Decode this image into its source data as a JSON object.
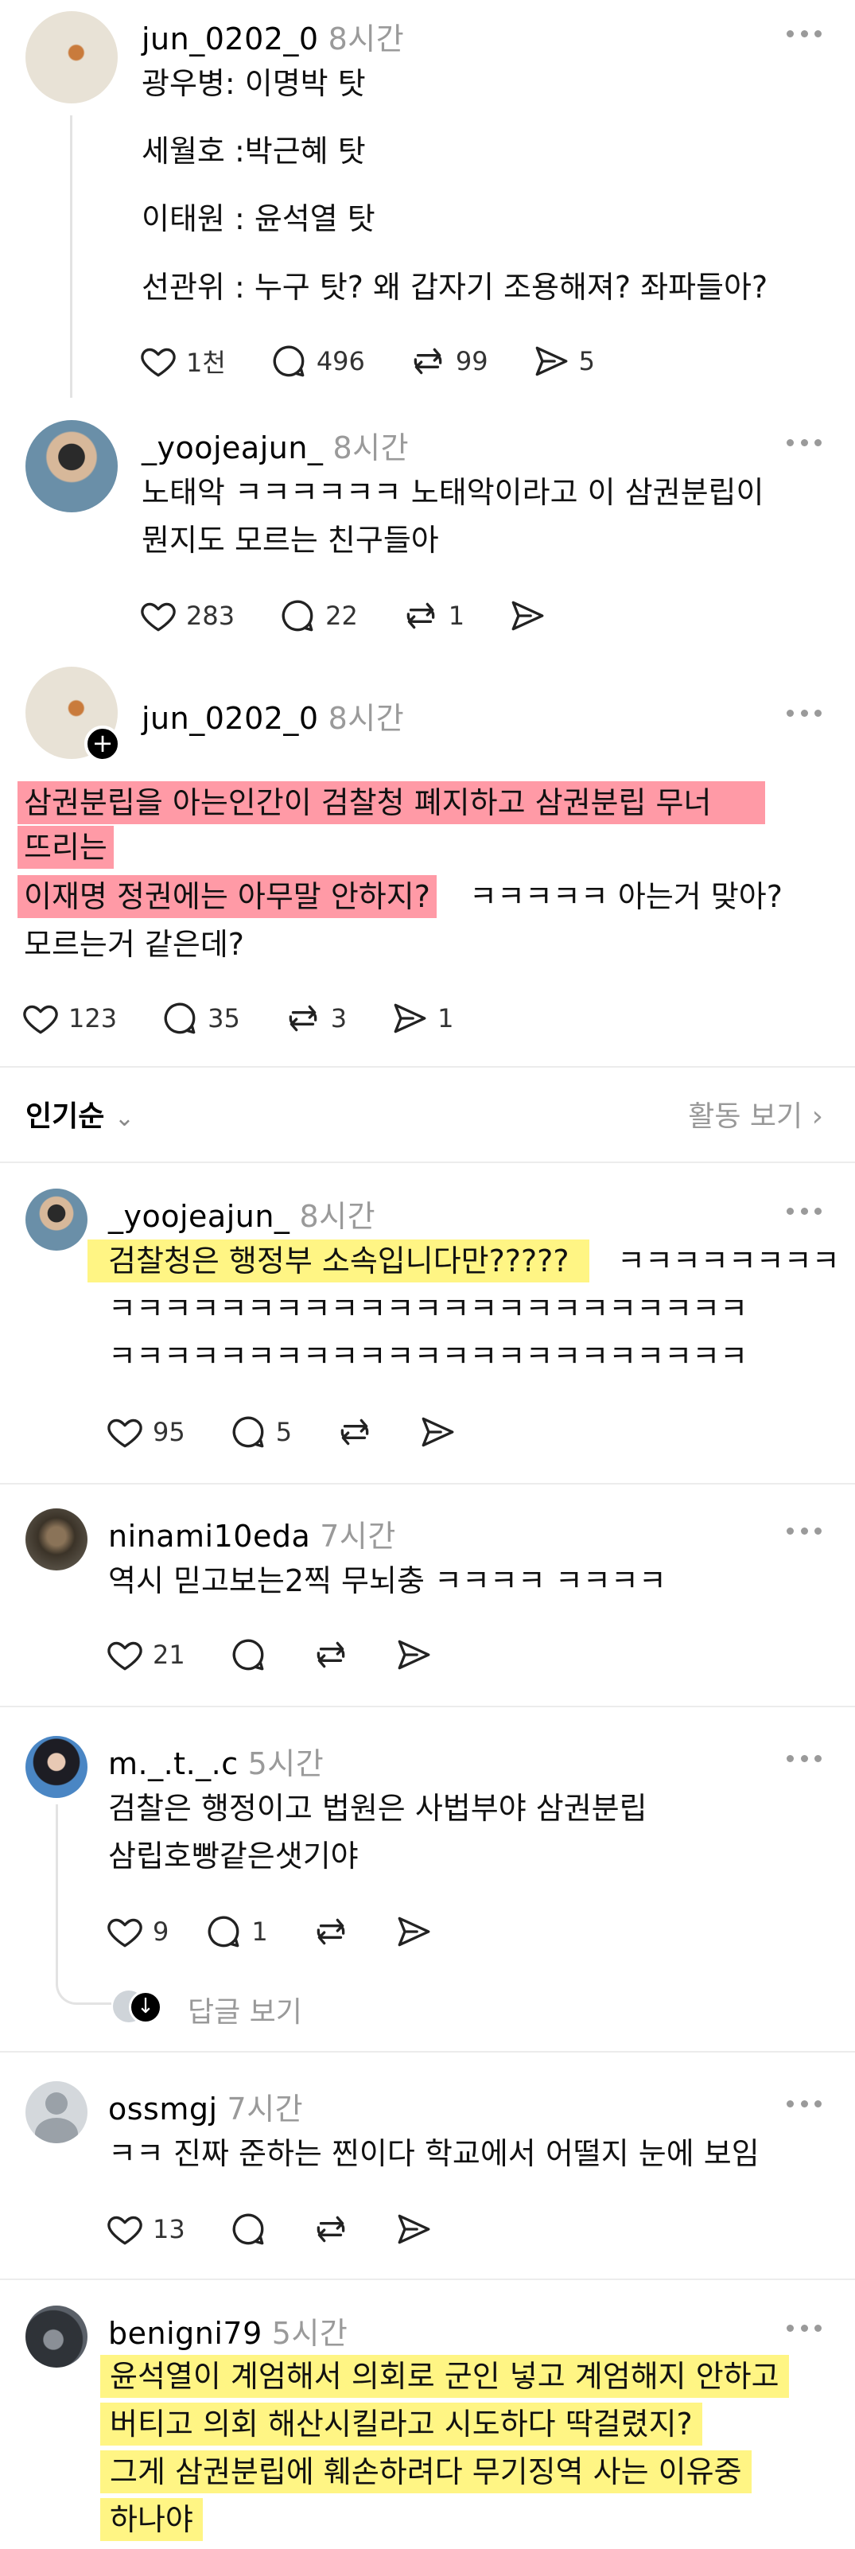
{
  "posts": [
    {
      "username": "jun_0202_0",
      "time": "8시간",
      "lines": [
        "광우병: 이명박 탓",
        "세월호 :박근혜 탓",
        "이태원 : 윤석열 탓",
        "선관위 : 누구 탓? 왜 갑자기 조용해져? 좌파들아?"
      ],
      "likes": "1천",
      "comments": "496",
      "reposts": "99",
      "shares": "5"
    },
    {
      "username": "_yoojeajun_",
      "time": "8시간",
      "lines": [
        "노태악 ㅋㅋㅋㅋㅋㅋ 노태악이라고 이 삼권분립이",
        "뭔지도 모르는 친구들아"
      ],
      "likes": "283",
      "comments": "22",
      "reposts": "1"
    },
    {
      "username": "jun_0202_0",
      "time": "8시간",
      "lines": [
        "삼권분립을 아는인간이 검찰청 폐지하고 삼권분립 무너",
        "뜨리는",
        "이재명 정권에는 아무말 안하지?",
        "ㅋㅋㅋㅋㅋ 아는거 맞아?",
        "모르는거 같은데?"
      ],
      "likes": "123",
      "comments": "35",
      "reposts": "3",
      "shares": "1"
    }
  ],
  "sort_bar": {
    "sort_label": "인기순",
    "activity_label": "활동 보기"
  },
  "replies": [
    {
      "username": "_yoojeajun_",
      "time": "8시간",
      "lines": [
        "검찰청은 행정부 소속입니다만?????",
        "ㅋㅋㅋㅋㅋㅋㅋㅋ",
        "ㅋㅋㅋㅋㅋㅋㅋㅋㅋㅋㅋㅋㅋㅋㅋㅋㅋㅋㅋㅋㅋㅋㅋ",
        "ㅋㅋㅋㅋㅋㅋㅋㅋㅋㅋㅋㅋㅋㅋㅋㅋㅋㅋㅋㅋㅋㅋㅋ"
      ],
      "likes": "95",
      "comments": "5"
    },
    {
      "username": "ninami10eda",
      "time": "7시간",
      "lines": [
        "역시 믿고보는2찍 무뇌충 ㅋㅋㅋㅋ ㅋㅋㅋㅋ"
      ],
      "likes": "21"
    },
    {
      "username": "m._.t._.c",
      "time": "5시간",
      "lines": [
        "검찰은 행정이고 법원은 사법부야 삼권분립",
        "삼립호빵같은샛기야"
      ],
      "likes": "9",
      "comments": "1",
      "view_replies": "답글 보기"
    },
    {
      "username": "ossmgj",
      "time": "7시간",
      "lines": [
        "ㅋㅋ 진짜 준하는 찐이다 학교에서 어떨지 눈에 보임"
      ],
      "likes": "13"
    },
    {
      "username": "benigni79",
      "time": "5시간",
      "lines": [
        "윤석열이 계엄해서 의회로 군인 넣고 계엄해지 안하고",
        "버티고 의회 해산시킬라고 시도하다 딱걸렸지?",
        "그게 삼권분립에 훼손하려다 무기징역 사는 이유중",
        "하나야"
      ]
    }
  ]
}
